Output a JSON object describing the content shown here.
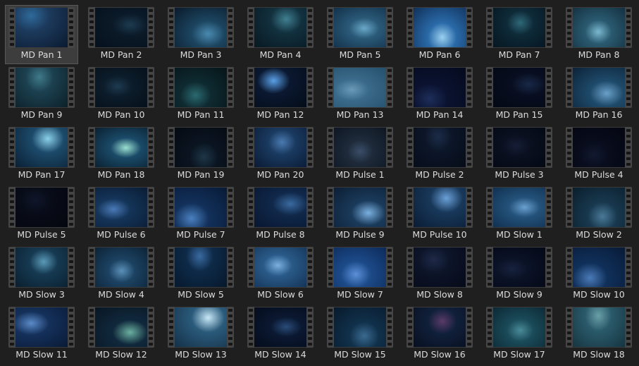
{
  "browser": {
    "selected_index": 0,
    "items": [
      {
        "label": "MD Pan 1",
        "icon": "video-clip-icon",
        "colors": [
          "#1d3a5c",
          "#0a1a30",
          "#2e6a9a"
        ]
      },
      {
        "label": "MD Pan 2",
        "icon": "video-clip-icon",
        "colors": [
          "#0b1a28",
          "#05101c",
          "#1d3a50"
        ]
      },
      {
        "label": "MD Pan 3",
        "icon": "video-clip-icon",
        "colors": [
          "#1c4560",
          "#0a1a2a",
          "#4a8ab0"
        ]
      },
      {
        "label": "MD Pan 4",
        "icon": "video-clip-icon",
        "colors": [
          "#12303e",
          "#081820",
          "#3f7f90"
        ]
      },
      {
        "label": "MD Pan 5",
        "icon": "video-clip-icon",
        "colors": [
          "#2a5a78",
          "#12304a",
          "#6aa8c8"
        ]
      },
      {
        "label": "MD Pan 6",
        "icon": "video-clip-icon",
        "colors": [
          "#2a6aa8",
          "#10305a",
          "#9ad0f0"
        ]
      },
      {
        "label": "MD Pan 7",
        "icon": "video-clip-icon",
        "colors": [
          "#0e2a38",
          "#061620",
          "#2f6878"
        ]
      },
      {
        "label": "MD Pan 8",
        "icon": "video-clip-icon",
        "colors": [
          "#2a5a70",
          "#143040",
          "#7ab8d0"
        ]
      },
      {
        "label": "MD Pan 9",
        "icon": "video-clip-icon",
        "colors": [
          "#1c4050",
          "#0c2028",
          "#3f7a88"
        ]
      },
      {
        "label": "MD Pan 10",
        "icon": "video-clip-icon",
        "colors": [
          "#0c1c2a",
          "#06101a",
          "#1e3a50"
        ]
      },
      {
        "label": "MD Pan 11",
        "icon": "video-clip-icon",
        "colors": [
          "#0e2a30",
          "#061418",
          "#2a6a70"
        ]
      },
      {
        "label": "MD Pan 12",
        "icon": "video-clip-icon",
        "colors": [
          "#0a1830",
          "#040c18",
          "#5aa0e8"
        ]
      },
      {
        "label": "MD Pan 13",
        "icon": "video-clip-icon",
        "colors": [
          "#3a6a8a",
          "#24506a",
          "#6a9ab8"
        ]
      },
      {
        "label": "MD Pan 14",
        "icon": "video-clip-icon",
        "colors": [
          "#0a1230",
          "#050a1c",
          "#1e2e5a"
        ]
      },
      {
        "label": "MD Pan 15",
        "icon": "video-clip-icon",
        "colors": [
          "#080e20",
          "#040814",
          "#182848"
        ]
      },
      {
        "label": "MD Pan 16",
        "icon": "video-clip-icon",
        "colors": [
          "#1e4a6a",
          "#0c2238",
          "#6aa0c8"
        ]
      },
      {
        "label": "MD Pan 17",
        "icon": "video-clip-icon",
        "colors": [
          "#1c4a6a",
          "#0a2034",
          "#8ad0e8"
        ]
      },
      {
        "label": "MD Pan 18",
        "icon": "video-clip-icon",
        "colors": [
          "#1a4a68",
          "#0a2030",
          "#9ae0d0"
        ]
      },
      {
        "label": "MD Pan 19",
        "icon": "video-clip-icon",
        "colors": [
          "#0a1420",
          "#050a12",
          "#1e3648"
        ]
      },
      {
        "label": "MD Pan 20",
        "icon": "video-clip-icon",
        "colors": [
          "#1a3a60",
          "#0a1a34",
          "#4a7ab0"
        ]
      },
      {
        "label": "MD Pulse 1",
        "icon": "video-clip-icon",
        "colors": [
          "#1e2a3a",
          "#0e1622",
          "#3a4e68"
        ]
      },
      {
        "label": "MD Pulse 2",
        "icon": "video-clip-icon",
        "colors": [
          "#0c1628",
          "#060c18",
          "#1c2c48"
        ]
      },
      {
        "label": "MD Pulse 3",
        "icon": "video-clip-icon",
        "colors": [
          "#0a1020",
          "#050814",
          "#161e36"
        ]
      },
      {
        "label": "MD Pulse 4",
        "icon": "video-clip-icon",
        "colors": [
          "#080c1c",
          "#040610",
          "#121a30"
        ]
      },
      {
        "label": "MD Pulse 5",
        "icon": "video-clip-icon",
        "colors": [
          "#080c18",
          "#04060e",
          "#10162a"
        ]
      },
      {
        "label": "MD Pulse 6",
        "icon": "video-clip-icon",
        "colors": [
          "#143458",
          "#0a1c34",
          "#4a7ab8"
        ]
      },
      {
        "label": "MD Pulse 7",
        "icon": "video-clip-icon",
        "colors": [
          "#12305a",
          "#081a36",
          "#4a80c0"
        ]
      },
      {
        "label": "MD Pulse 8",
        "icon": "video-clip-icon",
        "colors": [
          "#10284a",
          "#081630",
          "#3a6aa0"
        ]
      },
      {
        "label": "MD Pulse 9",
        "icon": "video-clip-icon",
        "colors": [
          "#1a3a5a",
          "#0c1e34",
          "#7ab0e0"
        ]
      },
      {
        "label": "MD Pulse 10",
        "icon": "video-clip-icon",
        "colors": [
          "#18385a",
          "#0a1c34",
          "#6aa0d8"
        ]
      },
      {
        "label": "MD Slow 1",
        "icon": "video-clip-icon",
        "colors": [
          "#24527a",
          "#103050",
          "#6aa0d0"
        ]
      },
      {
        "label": "MD Slow 2",
        "icon": "video-clip-icon",
        "colors": [
          "#18384e",
          "#0a1e2c",
          "#4a7a98"
        ]
      },
      {
        "label": "MD Slow 3",
        "icon": "video-clip-icon",
        "colors": [
          "#163a52",
          "#0a1e2e",
          "#5a9ab8"
        ]
      },
      {
        "label": "MD Slow 4",
        "icon": "video-clip-icon",
        "colors": [
          "#1c4262",
          "#0c2236",
          "#5a90b8"
        ]
      },
      {
        "label": "MD Slow 5",
        "icon": "video-clip-icon",
        "colors": [
          "#0e2a48",
          "#06182c",
          "#3a6aa0"
        ]
      },
      {
        "label": "MD Slow 6",
        "icon": "video-clip-icon",
        "colors": [
          "#2a5a88",
          "#143458",
          "#7ab0e0"
        ]
      },
      {
        "label": "MD Slow 7",
        "icon": "video-clip-icon",
        "colors": [
          "#1c4a88",
          "#0c2a5a",
          "#5a90d8"
        ]
      },
      {
        "label": "MD Slow 8",
        "icon": "video-clip-icon",
        "colors": [
          "#0c1428",
          "#060a18",
          "#1e2a48"
        ]
      },
      {
        "label": "MD Slow 9",
        "icon": "video-clip-icon",
        "colors": [
          "#0a1226",
          "#050816",
          "#18223e"
        ]
      },
      {
        "label": "MD Slow 10",
        "icon": "video-clip-icon",
        "colors": [
          "#10305a",
          "#081a36",
          "#4a7ab8"
        ]
      },
      {
        "label": "MD Slow 11",
        "icon": "video-clip-icon",
        "colors": [
          "#14305a",
          "#0a1a36",
          "#5a8ac8"
        ]
      },
      {
        "label": "MD Slow 12",
        "icon": "video-clip-icon",
        "colors": [
          "#10283c",
          "#081622",
          "#6ab0a0"
        ]
      },
      {
        "label": "MD Slow 13",
        "icon": "video-clip-icon",
        "colors": [
          "#2a5a7a",
          "#143048",
          "#c8e8f8"
        ]
      },
      {
        "label": "MD Slow 14",
        "icon": "video-clip-icon",
        "colors": [
          "#0a1830",
          "#050c1c",
          "#2a4a78"
        ]
      },
      {
        "label": "MD Slow 15",
        "icon": "video-clip-icon",
        "colors": [
          "#10304a",
          "#081a2c",
          "#3a6a90"
        ]
      },
      {
        "label": "MD Slow 16",
        "icon": "video-clip-icon",
        "colors": [
          "#10203a",
          "#080f20",
          "#5a3a6a"
        ]
      },
      {
        "label": "MD Slow 17",
        "icon": "video-clip-icon",
        "colors": [
          "#1a4a58",
          "#0c2834",
          "#4a8a98"
        ]
      },
      {
        "label": "MD Slow 18",
        "icon": "video-clip-icon",
        "colors": [
          "#2a5a6a",
          "#163440",
          "#6aa0a8"
        ]
      }
    ]
  }
}
